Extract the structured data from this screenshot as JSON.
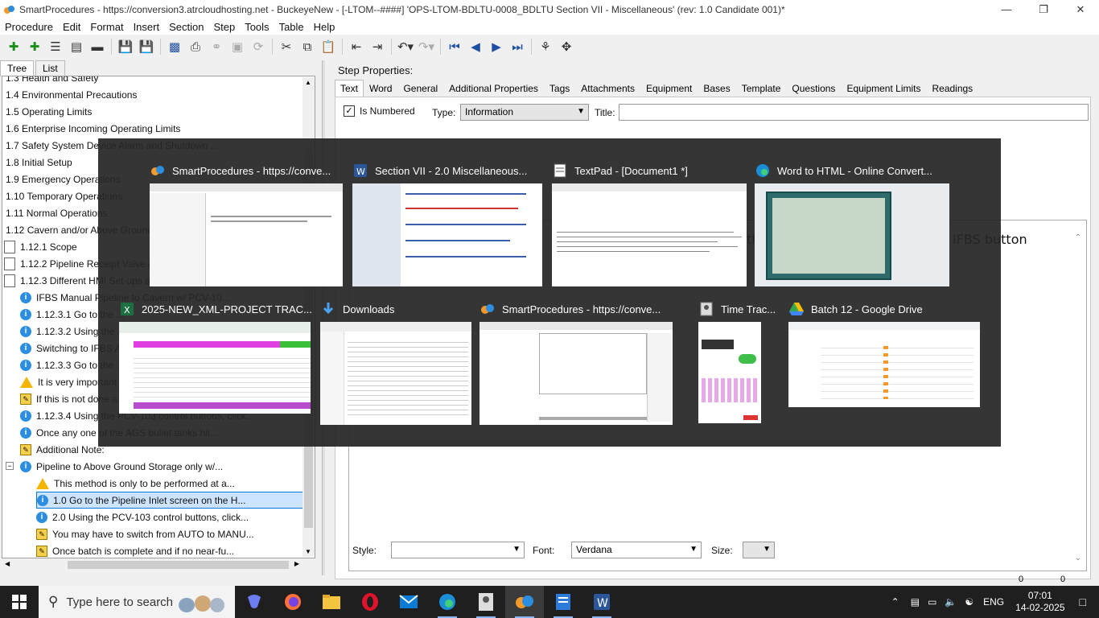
{
  "window": {
    "title": "SmartProcedures - https://conversion3.atrcloudhosting.net - BuckeyeNew - [-LTOM--####] 'OPS-LTOM-BDLTU-0008_BDLTU Section VII - Miscellaneous' (rev: 1.0 Candidate 001)*",
    "controls": [
      "minimize",
      "restore",
      "close"
    ]
  },
  "menu": [
    "Procedure",
    "Edit",
    "Format",
    "Insert",
    "Section",
    "Step",
    "Tools",
    "Table",
    "Help"
  ],
  "left_tabs": [
    "Tree",
    "List"
  ],
  "tree": [
    {
      "icon": "none",
      "text": "1.3 Health and Safety"
    },
    {
      "icon": "none",
      "text": "1.4 Environmental Precautions"
    },
    {
      "icon": "none",
      "text": "1.5 Operating Limits"
    },
    {
      "icon": "none",
      "text": "1.6 Enterprise Incoming Operating Limits"
    },
    {
      "icon": "none",
      "text": "1.7 Safety System Device Alarm and Shutdown ..."
    },
    {
      "icon": "none",
      "text": "1.8 Initial Setup"
    },
    {
      "icon": "none",
      "text": "1.9 Emergency Operations"
    },
    {
      "icon": "none",
      "text": "1.10 Temporary Operations"
    },
    {
      "icon": "none",
      "text": "1.11 Normal Operations"
    },
    {
      "icon": "none",
      "text": "1.12 Cavern and/or Above Ground ..."
    },
    {
      "icon": "doc",
      "text": "1.12.1 Scope"
    },
    {
      "icon": "doc",
      "text": "1.12.2 Pipeline Receipt Valve A..."
    },
    {
      "icon": "doc",
      "text": "1.12.3 Different HMI Set-ups a..."
    },
    {
      "icon": "info",
      "text": "IFBS Manual Pipeline to Cavern w/ PCV-10..."
    },
    {
      "icon": "info",
      "text": "1.12.3.1 Go to the ..."
    },
    {
      "icon": "info",
      "text": "1.12.3.2 Using the ..."
    },
    {
      "icon": "info",
      "text": "Switching to IFBS A..."
    },
    {
      "icon": "info",
      "text": "1.12.3.3 Go to the ..."
    },
    {
      "icon": "warn",
      "text": "It is very important ..."
    },
    {
      "icon": "note",
      "text": "If this is not done a..."
    },
    {
      "icon": "info",
      "text": "1.12.3.4 Using the PCV-103 control buttons, click..."
    },
    {
      "icon": "info",
      "text": "Once any one of the AGS bullet tanks hit..."
    },
    {
      "icon": "note",
      "text": "Additional Note:"
    },
    {
      "icon": "info",
      "text": "Pipeline to Above Ground Storage only w/..."
    },
    {
      "icon": "warn",
      "text": "This method is only to be performed at a..."
    },
    {
      "icon": "info",
      "text": "1.0 Go to the Pipeline Inlet screen on the H..."
    },
    {
      "icon": "info",
      "text": "2.0 Using the PCV-103 control buttons, click..."
    },
    {
      "icon": "note",
      "text": "You may have to switch from AUTO to MANU..."
    },
    {
      "icon": "note",
      "text": "Once batch is complete and if no near-fu..."
    }
  ],
  "step_properties": {
    "heading": "Step Properties:",
    "tabs": [
      "Text",
      "Word",
      "General",
      "Additional Properties",
      "Tags",
      "Attachments",
      "Equipment",
      "Bases",
      "Template",
      "Questions",
      "Equipment Limits",
      "Readings"
    ],
    "is_numbered_label": "Is Numbered",
    "is_numbered_checked": "✓",
    "type_label": "Type:",
    "type_value": "Information",
    "title_label": "Title:",
    "editor_text_visible": "IFBS button",
    "editor_text_partial": "th",
    "style_label": "Style:",
    "style_value": "",
    "font_label": "Font:",
    "font_value": "Verdana",
    "size_label": "Size:",
    "size_value": ""
  },
  "status": {
    "left_num": "0",
    "right_num": "0"
  },
  "switcher": [
    {
      "title": "SmartProcedures - https://conve...",
      "icon": "smartprocedures-icon"
    },
    {
      "title": "Section VII - 2.0 Miscellaneous...",
      "icon": "word-icon"
    },
    {
      "title": "TextPad - [Document1 *]",
      "icon": "textpad-icon"
    },
    {
      "title": "Word to HTML - Online Convert...",
      "icon": "edge-icon"
    },
    {
      "title": "2025-NEW_XML-PROJECT TRAC...",
      "icon": "excel-icon"
    },
    {
      "title": "Downloads",
      "icon": "downloads-icon"
    },
    {
      "title": "SmartProcedures - https://conve...",
      "icon": "smartprocedures-icon"
    },
    {
      "title": "Time Trac...",
      "icon": "timetracker-icon"
    },
    {
      "title": "Batch 12 - Google Drive",
      "icon": "drive-icon"
    }
  ],
  "taskbar": {
    "search_placeholder": "Type here to search",
    "language": "ENG",
    "time": "07:01",
    "date": "14-02-2025"
  }
}
